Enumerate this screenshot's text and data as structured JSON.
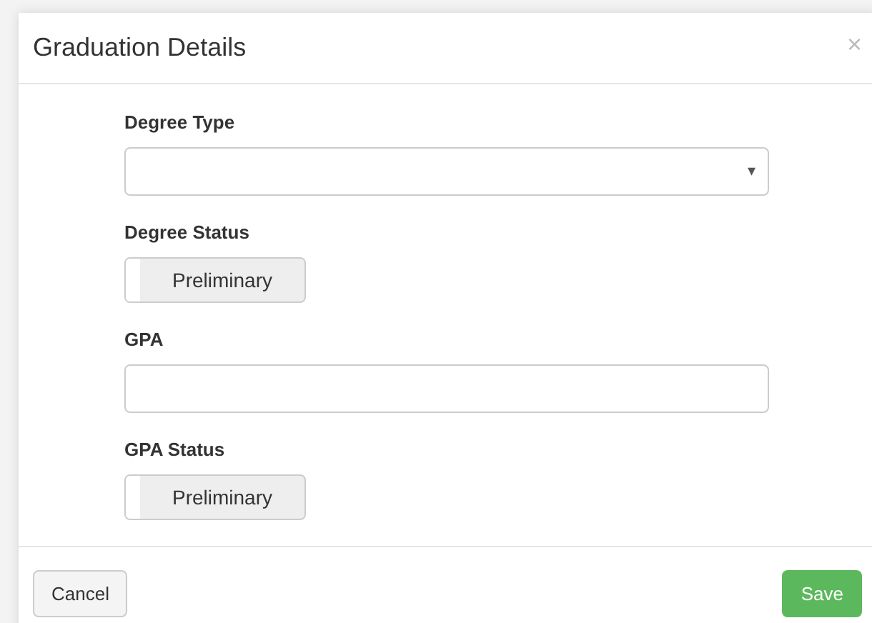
{
  "dialog": {
    "title": "Graduation Details",
    "close": "×"
  },
  "fields": [
    {
      "kind": "select",
      "label": "Degree Type",
      "caret": "▾"
    },
    {
      "kind": "toggle",
      "label": "Degree Status",
      "text": "Preliminary",
      "on": false
    },
    {
      "kind": "text",
      "label": "GPA"
    },
    {
      "kind": "toggle",
      "label": "GPA Status",
      "text": "Preliminary",
      "on": false
    }
  ],
  "footer": {
    "cancel": "Cancel",
    "save": "Save"
  }
}
